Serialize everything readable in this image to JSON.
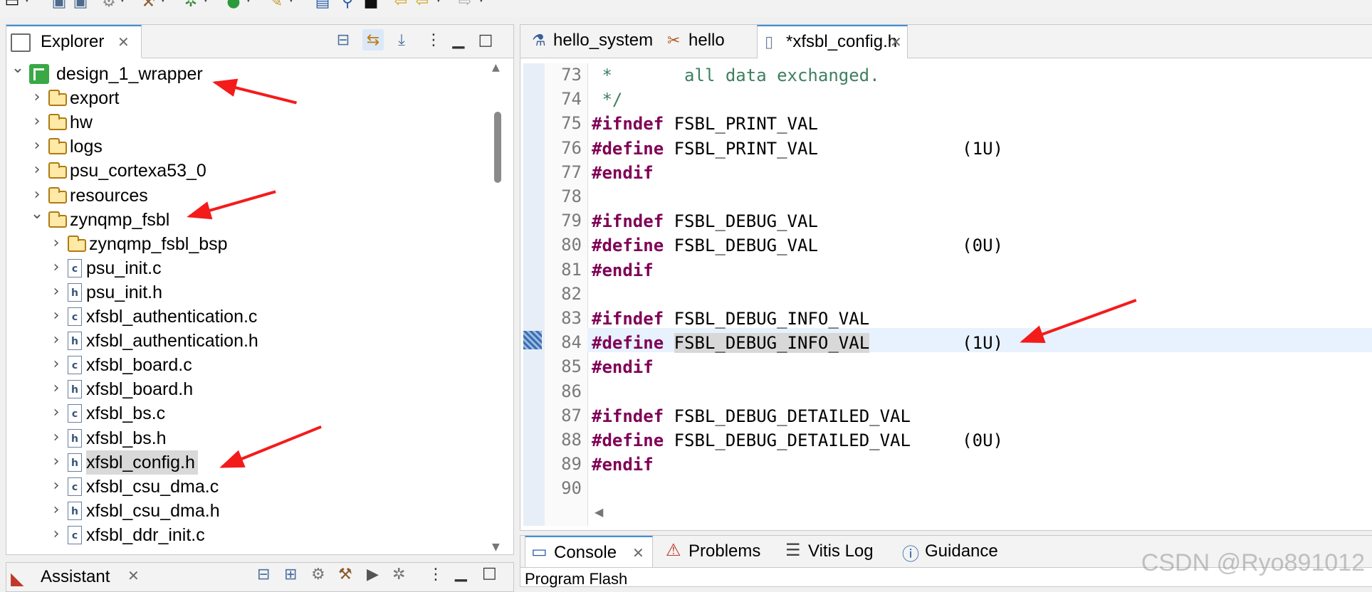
{
  "explorer": {
    "tab_title": "Explorer",
    "tree": [
      {
        "label": "design_1_wrapper",
        "expanded": true,
        "icon": "project-icon"
      },
      {
        "label": "export",
        "expanded": false,
        "icon": "folder-icon"
      },
      {
        "label": "hw",
        "expanded": false,
        "icon": "folder-icon"
      },
      {
        "label": "logs",
        "expanded": false,
        "icon": "folder-icon"
      },
      {
        "label": "psu_cortexa53_0",
        "expanded": false,
        "icon": "folder-icon"
      },
      {
        "label": "resources",
        "expanded": false,
        "icon": "folder-icon"
      },
      {
        "label": "zynqmp_fsbl",
        "expanded": true,
        "icon": "folder-icon"
      },
      {
        "label": "zynqmp_fsbl_bsp",
        "expanded": false,
        "icon": "folder-icon"
      },
      {
        "label": "psu_init.c",
        "expanded": false,
        "icon": "c-file-icon",
        "badge": "c"
      },
      {
        "label": "psu_init.h",
        "expanded": false,
        "icon": "h-file-icon",
        "badge": "h"
      },
      {
        "label": "xfsbl_authentication.c",
        "expanded": false,
        "icon": "c-file-icon",
        "badge": "c"
      },
      {
        "label": "xfsbl_authentication.h",
        "expanded": false,
        "icon": "h-file-icon",
        "badge": "h"
      },
      {
        "label": "xfsbl_board.c",
        "expanded": false,
        "icon": "c-file-icon",
        "badge": "c"
      },
      {
        "label": "xfsbl_board.h",
        "expanded": false,
        "icon": "h-file-icon",
        "badge": "h"
      },
      {
        "label": "xfsbl_bs.c",
        "expanded": false,
        "icon": "c-file-icon",
        "badge": "c"
      },
      {
        "label": "xfsbl_bs.h",
        "expanded": false,
        "icon": "h-file-icon",
        "badge": "h"
      },
      {
        "label": "xfsbl_config.h",
        "expanded": false,
        "icon": "h-file-icon",
        "badge": "h",
        "selected": true
      },
      {
        "label": "xfsbl_csu_dma.c",
        "expanded": false,
        "icon": "c-file-icon",
        "badge": "c"
      },
      {
        "label": "xfsbl_csu_dma.h",
        "expanded": false,
        "icon": "h-file-icon",
        "badge": "h"
      },
      {
        "label": "xfsbl_ddr_init.c",
        "expanded": false,
        "icon": "c-file-icon",
        "badge": "c"
      }
    ]
  },
  "editor": {
    "tabs": [
      {
        "label": "hello_system",
        "icon": "flask-icon"
      },
      {
        "label": "hello",
        "icon": "tools-icon"
      },
      {
        "label": "*xfsbl_config.h",
        "icon": "h-file-icon",
        "active": true
      }
    ],
    "lines": [
      {
        "n": "73",
        "parts": [
          {
            "t": " *       all data exchanged.",
            "c": "cmt"
          }
        ]
      },
      {
        "n": "74",
        "parts": [
          {
            "t": " */",
            "c": "cmt"
          }
        ]
      },
      {
        "n": "75",
        "parts": [
          {
            "t": "#ifndef",
            "c": "kw"
          },
          {
            "t": " FSBL_PRINT_VAL",
            "c": ""
          }
        ]
      },
      {
        "n": "76",
        "parts": [
          {
            "t": "#define",
            "c": "kw"
          },
          {
            "t": " FSBL_PRINT_VAL              (1U)",
            "c": ""
          }
        ]
      },
      {
        "n": "77",
        "parts": [
          {
            "t": "#endif",
            "c": "kw"
          }
        ]
      },
      {
        "n": "78",
        "parts": []
      },
      {
        "n": "79",
        "parts": [
          {
            "t": "#ifndef",
            "c": "kw"
          },
          {
            "t": " FSBL_DEBUG_VAL",
            "c": ""
          }
        ]
      },
      {
        "n": "80",
        "parts": [
          {
            "t": "#define",
            "c": "kw"
          },
          {
            "t": " FSBL_DEBUG_VAL              (0U)",
            "c": ""
          }
        ]
      },
      {
        "n": "81",
        "parts": [
          {
            "t": "#endif",
            "c": "kw"
          }
        ]
      },
      {
        "n": "82",
        "parts": []
      },
      {
        "n": "83",
        "parts": [
          {
            "t": "#ifndef",
            "c": "kw"
          },
          {
            "t": " FSBL_DEBUG_INFO_VAL",
            "c": ""
          }
        ]
      },
      {
        "n": "84",
        "parts": [
          {
            "t": "#define",
            "c": "kw"
          },
          {
            "t": " ",
            "c": ""
          },
          {
            "t": "FSBL_DEBUG_INFO_VAL",
            "c": "sel"
          },
          {
            "t": "         (1U)",
            "c": ""
          }
        ],
        "current": true
      },
      {
        "n": "85",
        "parts": [
          {
            "t": "#endif",
            "c": "kw"
          }
        ]
      },
      {
        "n": "86",
        "parts": []
      },
      {
        "n": "87",
        "parts": [
          {
            "t": "#ifndef",
            "c": "kw"
          },
          {
            "t": " FSBL_DEBUG_DETAILED_VAL",
            "c": ""
          }
        ]
      },
      {
        "n": "88",
        "parts": [
          {
            "t": "#define",
            "c": "kw"
          },
          {
            "t": " FSBL_DEBUG_DETAILED_VAL     (0U)",
            "c": ""
          }
        ]
      },
      {
        "n": "89",
        "parts": [
          {
            "t": "#endif",
            "c": "kw"
          }
        ]
      },
      {
        "n": "90",
        "parts": []
      }
    ]
  },
  "console": {
    "tabs": [
      {
        "label": "Console",
        "icon": "console-icon",
        "active": true
      },
      {
        "label": "Problems",
        "icon": "problems-icon"
      },
      {
        "label": "Vitis Log",
        "icon": "log-icon"
      },
      {
        "label": "Guidance",
        "icon": "info-icon"
      }
    ],
    "content": "Program Flash"
  },
  "assistant": {
    "tab_title": "Assistant"
  },
  "watermark": "CSDN @Ryo891012",
  "colors": {
    "keyword": "#7f0055",
    "comment": "#3f7f5f",
    "annotation_arrow": "#f41b1b",
    "accent": "#3f8fd8"
  }
}
